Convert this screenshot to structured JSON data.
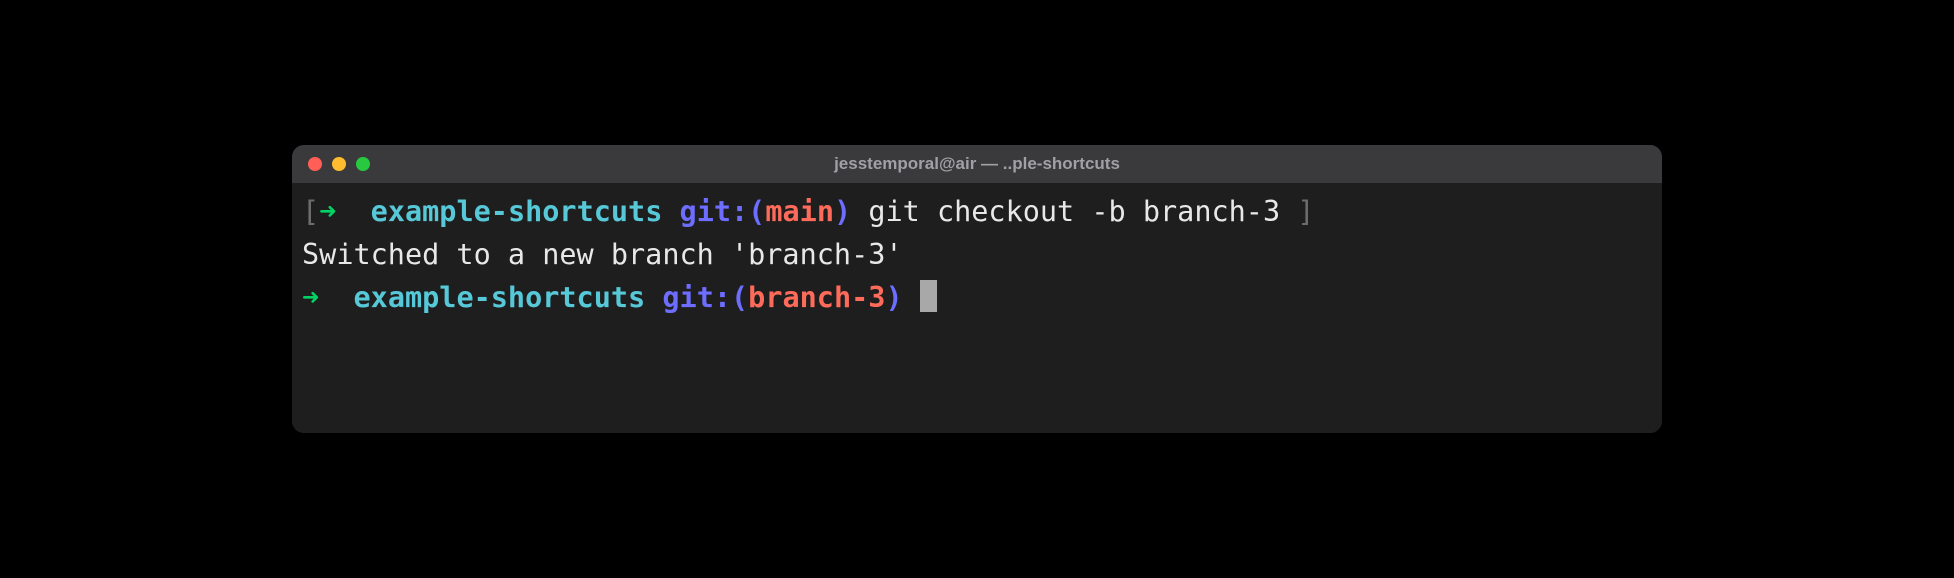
{
  "window": {
    "title": "jesstemporal@air — ..ple-shortcuts"
  },
  "lines": {
    "line1": {
      "bracket_open": "[",
      "arrow": "➜",
      "dir": "example-shortcuts",
      "git_label": "git:(",
      "branch": "main",
      "git_close": ")",
      "command": " git checkout -b branch-3 ",
      "bracket_close": "]"
    },
    "line2": {
      "output": "Switched to a new branch 'branch-3'"
    },
    "line3": {
      "arrow": "➜",
      "dir": "example-shortcuts",
      "git_label": "git:(",
      "branch": "branch-3",
      "git_close": ")"
    }
  }
}
